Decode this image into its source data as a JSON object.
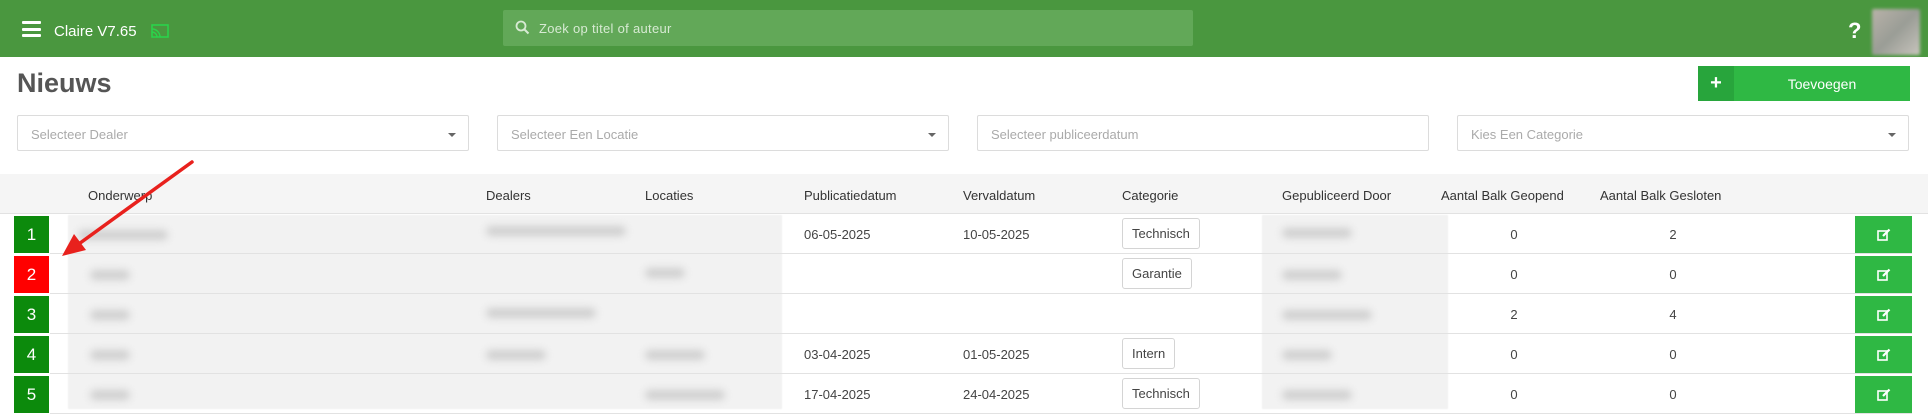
{
  "app": {
    "title": "Claire V7.65"
  },
  "search": {
    "placeholder": "Zoek op titel of auteur"
  },
  "page": {
    "title": "Nieuws"
  },
  "toolbar": {
    "add_label": "Toevoegen"
  },
  "filters": {
    "dealer": "Selecteer Dealer",
    "location": "Selecteer Een Locatie",
    "publish_date": "Selecteer publiceerdatum",
    "category": "Kies Een Categorie"
  },
  "table": {
    "columns": {
      "subject": "Onderwerp",
      "dealers": "Dealers",
      "locations": "Locaties",
      "published": "Publicatiedatum",
      "expires": "Vervaldatum",
      "category": "Categorie",
      "published_by": "Gepubliceerd Door",
      "opened": "Aantal Balk Geopend",
      "closed": "Aantal Balk Gesloten"
    },
    "rows": [
      {
        "index": "1",
        "status": "active",
        "published": "06-05-2025",
        "expires": "10-05-2025",
        "category": "Technisch",
        "opened": "0",
        "closed": "2"
      },
      {
        "index": "2",
        "status": "inactive",
        "published": "",
        "expires": "",
        "category": "Garantie",
        "opened": "0",
        "closed": "0"
      },
      {
        "index": "3",
        "status": "active",
        "published": "",
        "expires": "",
        "category": "",
        "opened": "2",
        "closed": "4"
      },
      {
        "index": "4",
        "status": "active",
        "published": "03-04-2025",
        "expires": "01-05-2025",
        "category": "Intern",
        "opened": "0",
        "closed": "0"
      },
      {
        "index": "5",
        "status": "active",
        "published": "17-04-2025",
        "expires": "24-04-2025",
        "category": "Technisch",
        "opened": "0",
        "closed": "0"
      }
    ]
  },
  "colors": {
    "topbar": "#4a973f",
    "accent_green": "#2fb844",
    "status_active": "#0c8a0c",
    "status_inactive": "#ff0000",
    "annotation_arrow": "#e8211d"
  },
  "icons": {
    "menu": "hamburger-icon",
    "cast": "cast-icon",
    "search": "search-icon",
    "help": "question-icon",
    "add": "plus-icon",
    "edit": "edit-icon"
  }
}
